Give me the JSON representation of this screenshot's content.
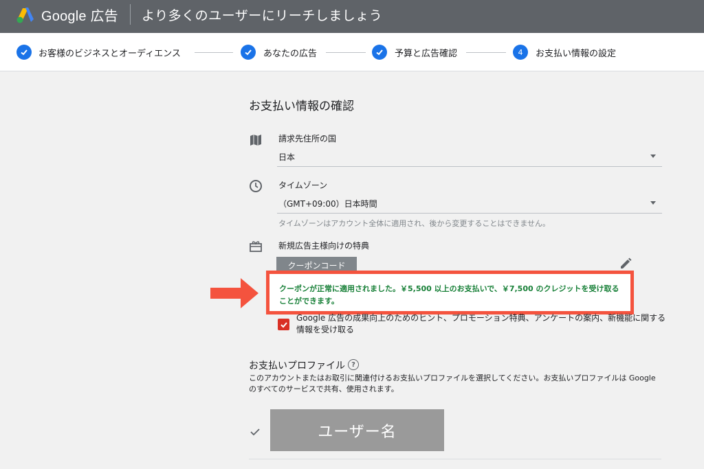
{
  "header": {
    "brand": "Google 広告",
    "title": "より多くのユーザーにリーチしましょう"
  },
  "stepper": {
    "steps": [
      {
        "label": "お客様のビジネスとオーディエンス",
        "status": "done"
      },
      {
        "label": "あなたの広告",
        "status": "done"
      },
      {
        "label": "予算と広告確認",
        "status": "done"
      },
      {
        "label": "お支払い情報の設定",
        "status": "current",
        "number": "4"
      }
    ]
  },
  "section_title": "お支払い情報の確認",
  "billing_country": {
    "icon": "map-icon",
    "label": "請求先住所の国",
    "value": "日本"
  },
  "timezone": {
    "icon": "clock-icon",
    "label": "タイムゾーン",
    "value": "（GMT+09:00）日本時間",
    "helper": "タイムゾーンはアカウント全体に適用され、後から変更することはできません。"
  },
  "promo": {
    "icon": "gift-icon",
    "label": "新規広告主様向けの特典",
    "button": "クーポンコード",
    "edit_icon": "pencil-icon",
    "success_message": "クーポンが正常に適用されました。￥5,500 以上のお支払いで、￥7,500 のクレジットを受け取ることができます。"
  },
  "marketing_checkbox": {
    "checked": true,
    "label": "Google 広告の成果向上のためのヒント、プロモーション特典、アンケートの案内、新機能に関する情報を受け取る"
  },
  "payment_profile": {
    "title": "お支払いプロファイル",
    "description": "このアカウントまたはお取引に関連付けるお支払いプロファイルを選択してください。お支払いプロファイルは Google のすべてのサービスで共有、使用されます。",
    "username": "ユーザー名"
  },
  "colors": {
    "header_bg": "#5f6368",
    "accent": "#1a73e8",
    "success": "#188038",
    "highlight": "#f4533e",
    "checkbox": "#d93025"
  }
}
